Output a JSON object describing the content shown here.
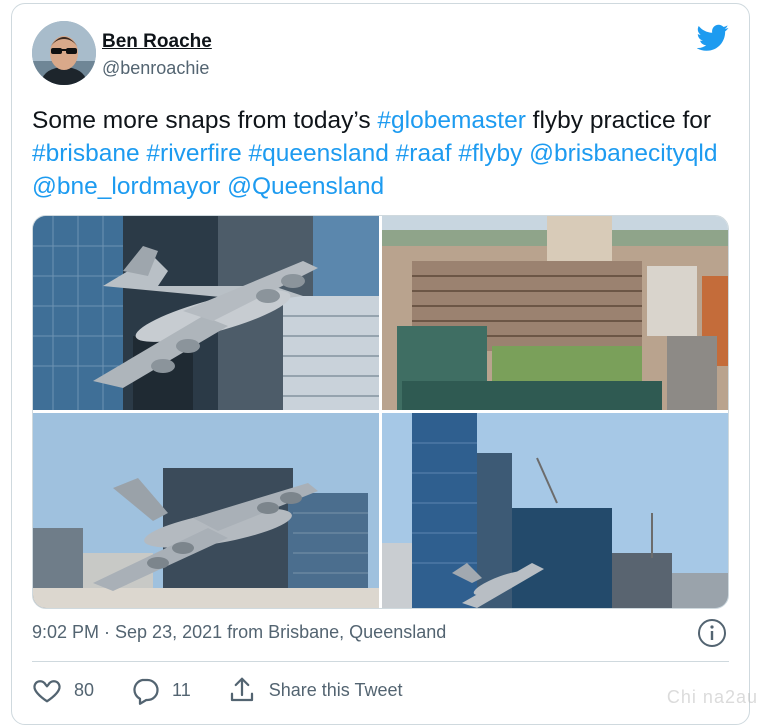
{
  "author": {
    "name": "Ben Roache",
    "handle": "@benroachie"
  },
  "tweet": {
    "segments": [
      {
        "text": "Some more snaps from today’s ",
        "link": false
      },
      {
        "text": "#globemaster",
        "link": true
      },
      {
        "text": " flyby practice for ",
        "link": false
      },
      {
        "text": "#brisbane",
        "link": true
      },
      {
        "text": " ",
        "link": false
      },
      {
        "text": "#riverfire",
        "link": true
      },
      {
        "text": " ",
        "link": false
      },
      {
        "text": "#queensland",
        "link": true
      },
      {
        "text": " ",
        "link": false
      },
      {
        "text": "#raaf",
        "link": true
      },
      {
        "text": " ",
        "link": false
      },
      {
        "text": "#flyby",
        "link": true
      },
      {
        "text": " ",
        "link": false
      },
      {
        "text": "@brisbanecityqld",
        "link": true
      },
      {
        "text": " ",
        "link": false
      },
      {
        "text": "@bne_lordmayor",
        "link": true
      },
      {
        "text": " ",
        "link": false
      },
      {
        "text": "@Queensland",
        "link": true
      }
    ]
  },
  "meta": {
    "timestamp": "9:02 PM · Sep 23, 2021 from Brisbane, Queensland"
  },
  "actions": {
    "likes": "80",
    "replies": "11",
    "share_label": "Share this Tweet"
  },
  "icons": {
    "bird": "twitter-bird-icon",
    "info": "info-icon",
    "like": "heart-icon",
    "reply": "reply-bubble-icon",
    "share": "share-upload-icon"
  },
  "colors": {
    "link": "#1d9bf0",
    "muted": "#536471",
    "text": "#0f1419"
  },
  "watermark": "Chi na2au"
}
